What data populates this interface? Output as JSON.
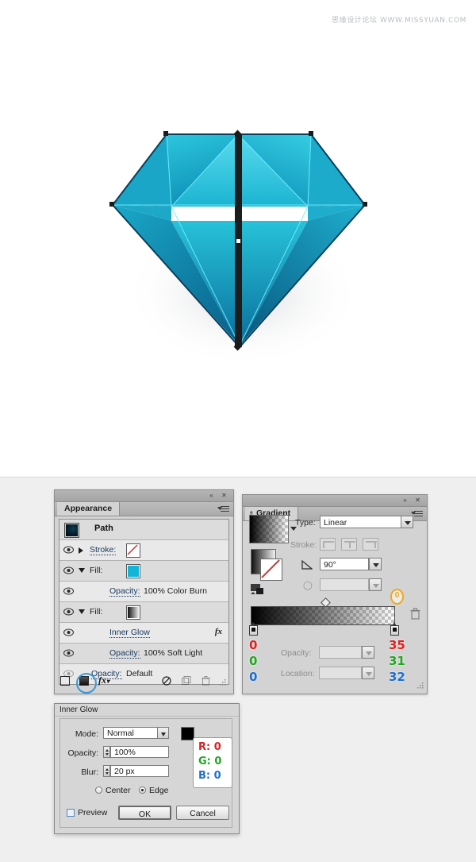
{
  "canvas": {
    "watermark": "思缘设计论坛  WWW.MISSYUAN.COM",
    "artwork_name": "diamond-illustration",
    "colors": {
      "diamond_light": "#3fd0e4",
      "diamond_mid": "#12a9cc",
      "diamond_dark": "#0b6d9c",
      "diamond_deep": "#095c86",
      "facet_line": "#6ff0ff",
      "selection_path": "#121212"
    }
  },
  "appearance_panel": {
    "tab_label": "Appearance",
    "object_name": "Path",
    "rows": [
      {
        "label": "Stroke:",
        "value": "",
        "swatch": "none",
        "disclosure": "right",
        "visible": true
      },
      {
        "label": "Fill:",
        "value": "",
        "swatch": "cyan",
        "disclosure": "down",
        "visible": true
      },
      {
        "label": "Opacity:",
        "value": "100% Color Burn",
        "swatch": "",
        "disclosure": "",
        "visible": true
      },
      {
        "label": "Fill:",
        "value": "",
        "swatch": "gradient",
        "disclosure": "down",
        "visible": true
      },
      {
        "label": "Inner Glow",
        "value": "",
        "swatch": "",
        "disclosure": "",
        "visible": true,
        "fx": "fx"
      },
      {
        "label": "Opacity:",
        "value": "100% Soft Light",
        "swatch": "",
        "disclosure": "",
        "visible": true
      },
      {
        "label": "Opacity:",
        "value": "Default",
        "swatch": "",
        "disclosure": "",
        "visible": false
      }
    ],
    "footer_buttons": [
      "add-new-stroke-button",
      "add-new-fill-button",
      "add-new-effect-button",
      "clear-appearance-button",
      "duplicate-item-button",
      "delete-item-button"
    ],
    "titlebar": {
      "collapse": "«",
      "close": "✕"
    }
  },
  "gradient_panel": {
    "tab_label": "Gradient",
    "type_label": "Type:",
    "type_value": "Linear",
    "stroke_label": "Stroke:",
    "angle_value": "90°",
    "aspect_value": "",
    "opacity_label": "Opacity:",
    "opacity_value": "",
    "location_label": "Location:",
    "location_value": "",
    "left_stop": {
      "r": "0",
      "g": "0",
      "b": "0"
    },
    "right_stop": {
      "r": "35",
      "g": "31",
      "b": "32"
    },
    "right_stop_opacity_badge": "0",
    "titlebar": {
      "collapse": "«",
      "close": "✕"
    }
  },
  "inner_glow_dialog": {
    "title": "Inner Glow",
    "mode_label": "Mode:",
    "mode_value": "Normal",
    "opacity_label": "Opacity:",
    "opacity_value": "100%",
    "blur_label": "Blur:",
    "blur_value": "20 px",
    "center_label": "Center",
    "edge_label": "Edge",
    "selected_origin": "Edge",
    "preview_label": "Preview",
    "preview_checked": false,
    "ok_label": "OK",
    "cancel_label": "Cancel",
    "color_rgb": {
      "r": "R: 0",
      "g": "G: 0",
      "b": "B: 0"
    },
    "color_hex": "#000000"
  }
}
